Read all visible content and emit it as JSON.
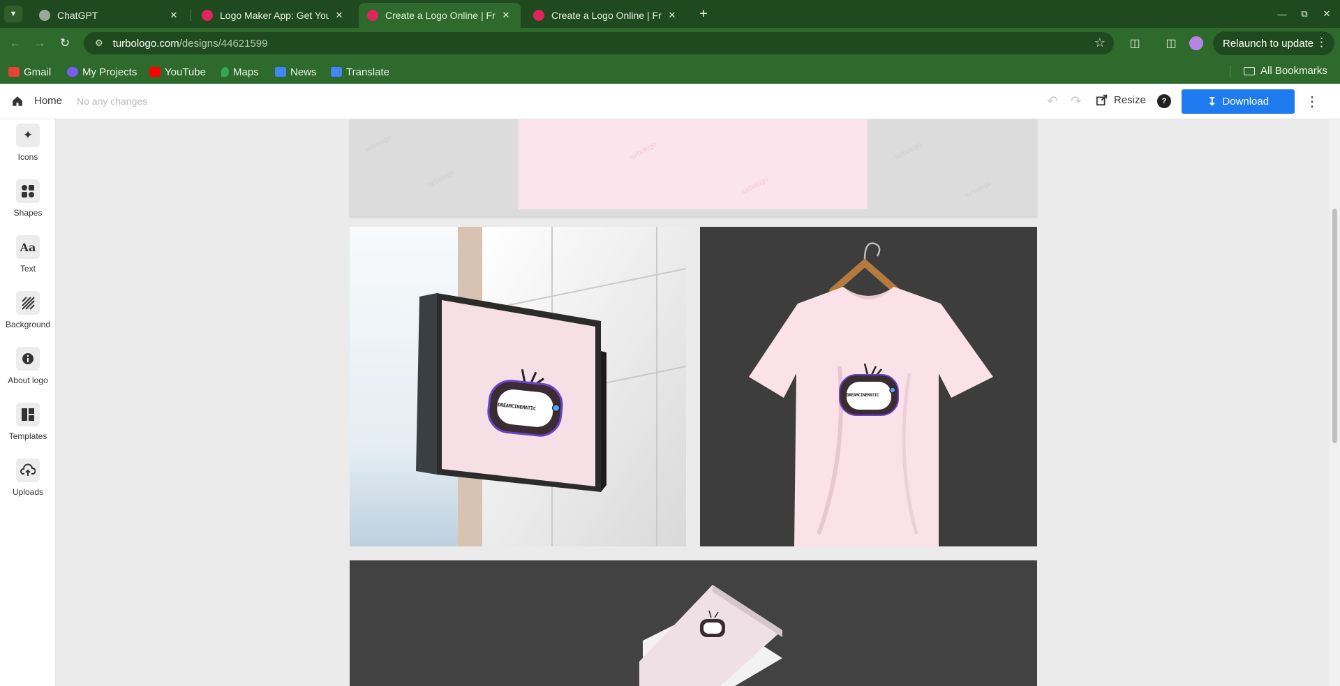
{
  "browser": {
    "tabs": [
      {
        "title": "ChatGPT",
        "favicon_color": "#9aa89a",
        "active": false
      },
      {
        "title": "Logo Maker App: Get Your",
        "favicon_color": "#e0245e",
        "active": false
      },
      {
        "title": "Create a Logo Online | Fre",
        "favicon_color": "#e0245e",
        "active": true
      },
      {
        "title": "Create a Logo Online | Fre",
        "favicon_color": "#e0245e",
        "active": false
      }
    ],
    "url_host": "turbologo.com",
    "url_path": "/designs/44621599",
    "relaunch_label": "Relaunch to update",
    "bookmarks": [
      {
        "label": "Gmail",
        "icon_color": "#ea4335"
      },
      {
        "label": "My Projects",
        "icon_color": "#7b5cf0"
      },
      {
        "label": "YouTube",
        "icon_color": "#ff0000"
      },
      {
        "label": "Maps",
        "icon_color": "#34a853"
      },
      {
        "label": "News",
        "icon_color": "#4285f4"
      },
      {
        "label": "Translate",
        "icon_color": "#4285f4"
      }
    ],
    "all_bookmarks_label": "All Bookmarks"
  },
  "header": {
    "home_label": "Home",
    "changes_status": "No any changes",
    "resize_label": "Resize",
    "download_label": "Download",
    "help_glyph": "?"
  },
  "sidebar": {
    "items": [
      {
        "label": "Icons",
        "icon": "sparkle-icon"
      },
      {
        "label": "Shapes",
        "icon": "shapes-icon"
      },
      {
        "label": "Text",
        "icon": "text-icon"
      },
      {
        "label": "Background",
        "icon": "background-icon"
      },
      {
        "label": "About logo",
        "icon": "info-icon"
      },
      {
        "label": "Templates",
        "icon": "templates-icon"
      },
      {
        "label": "Uploads",
        "icon": "upload-icon"
      }
    ]
  },
  "canvas": {
    "watermark_text": "turbologo",
    "logo_text": "DREAMCINEMATIC",
    "mockups": [
      "signboard",
      "t-shirt",
      "business-cards"
    ]
  },
  "colors": {
    "chrome_dark": "#1f4a1f",
    "chrome_mid": "#2e6a2b",
    "accent_blue": "#1d7aef",
    "logo_pink": "#fce4ec"
  }
}
